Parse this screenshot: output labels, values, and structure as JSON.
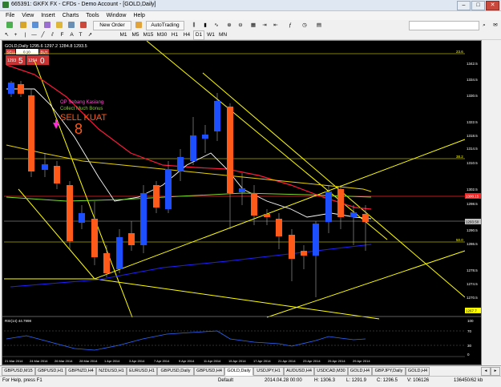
{
  "window": {
    "title": "665391: GKFX FX - CFDs - Demo Account - [GOLD,Daily]"
  },
  "menu": [
    "File",
    "View",
    "Insert",
    "Charts",
    "Tools",
    "Window",
    "Help"
  ],
  "toolbar": {
    "new_order": "New Order",
    "autotrading": "AutoTrading",
    "timeframes": [
      "M1",
      "M5",
      "M15",
      "M30",
      "H1",
      "H4",
      "D1",
      "W1",
      "MN"
    ]
  },
  "chart": {
    "header": "GOLD,Daily  1295.6 1297.2 1284.8 1293.5",
    "trade_panel": {
      "sell": "SELL",
      "buy": "BUY",
      "lot": "0.10",
      "bid_main": "1293",
      "bid_pip": "5",
      "ask_main": "1294",
      "ask_pip": "0"
    },
    "annotations": {
      "line1": "OP Sebang Kasiang",
      "line2": "Collect Much Bonus",
      "signal": "SELL KUAT",
      "digit": "8"
    },
    "price_labels": {
      "l23": "23.6",
      "l38": "38.2",
      "l50": "50.0",
      "current": "1300.15",
      "bid": "1293.50",
      "low": "1267.7"
    },
    "y_ticks": [
      "1342.5",
      "1334.5",
      "1330.5",
      "1322.5",
      "1318.5",
      "1314.5",
      "1310.5",
      "1302.5",
      "1298.5",
      "1290.5",
      "1286.5",
      "1278.5",
      "1274.5",
      "1270.5"
    ],
    "x_ticks": [
      "21 Mar 2014",
      "24 Mar 2014",
      "26 Mar 2014",
      "28 Mar 2014",
      "1 Apr 2014",
      "3 Apr 2014",
      "7 Apr 2014",
      "9 Apr 2014",
      "11 Apr 2014",
      "15 Apr 2014",
      "17 Apr 2014",
      "21 Apr 2014",
      "23 Apr 2014",
      "25 Apr 2014",
      "29 Apr 2014"
    ],
    "rsi": {
      "label": "RSI(14) 44.7998",
      "ticks": [
        "100",
        "70",
        "30",
        "0"
      ]
    },
    "colors": {
      "bull": "#1d4fff",
      "bear": "#ff5a1a",
      "fibo": "#ffff00",
      "red_ma": "#ff1a3a",
      "white_ma": "#ffffff",
      "green_ma": "#7bdc2a",
      "blue_ma": "#2020ff"
    }
  },
  "tabs": [
    "GBPUSD,M15",
    "GBPUSD,H1",
    "GBPNZD,H4",
    "NZDUSD,H1",
    "EURUSD,H1",
    "GBPUSD,Daily",
    "GBPUSD,H4",
    "GOLD,Daily",
    "USDJPY,H1",
    "AUDUSD,H4",
    "USDCAD,M30",
    "GOLD,H4",
    "GBPJPY,Daily",
    "GOLD,H4"
  ],
  "status": {
    "help": "For Help, press F1",
    "profile": "Default",
    "time": "2014.04.28 00:00",
    "h": "H: 1306.3",
    "l": "L: 1291.9",
    "c": "C: 1296.5",
    "v": "V: 106126",
    "traffic": "136450/62 kb"
  }
}
